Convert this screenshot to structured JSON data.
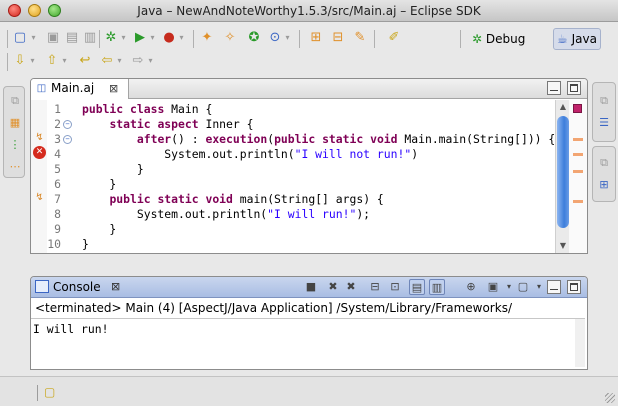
{
  "window": {
    "title": "Java – NewAndNoteWorthy1.5.3/src/Main.aj – Eclipse SDK"
  },
  "perspectives": {
    "debug": "Debug",
    "java": "Java"
  },
  "editor": {
    "tab_label": "Main.aj",
    "lines": [
      {
        "num": "1",
        "tokens": [
          {
            "k": "kw",
            "t": "public"
          },
          {
            "t": " "
          },
          {
            "k": "kw",
            "t": "class"
          },
          {
            "t": " Main {"
          }
        ]
      },
      {
        "num": "2",
        "tokens": [
          {
            "t": "    "
          },
          {
            "k": "kw",
            "t": "static"
          },
          {
            "t": " "
          },
          {
            "k": "kw",
            "t": "aspect"
          },
          {
            "t": " Inner {"
          }
        ]
      },
      {
        "num": "3",
        "tokens": [
          {
            "t": "        "
          },
          {
            "k": "kw",
            "t": "after"
          },
          {
            "t": "() : "
          },
          {
            "k": "kw",
            "t": "execution"
          },
          {
            "t": "("
          },
          {
            "k": "kw",
            "t": "public"
          },
          {
            "t": " "
          },
          {
            "k": "kw",
            "t": "static"
          },
          {
            "t": " "
          },
          {
            "k": "kw",
            "t": "void"
          },
          {
            "t": " Main.main(String[])) {"
          }
        ]
      },
      {
        "num": "4",
        "tokens": [
          {
            "t": "            System.out.println("
          },
          {
            "k": "str",
            "t": "\"I will not run!\""
          },
          {
            "t": ")"
          }
        ]
      },
      {
        "num": "5",
        "tokens": [
          {
            "t": "        }"
          }
        ]
      },
      {
        "num": "6",
        "tokens": [
          {
            "t": "    }"
          }
        ]
      },
      {
        "num": "7",
        "tokens": [
          {
            "t": "    "
          },
          {
            "k": "kw",
            "t": "public"
          },
          {
            "t": " "
          },
          {
            "k": "kw",
            "t": "static"
          },
          {
            "t": " "
          },
          {
            "k": "kw",
            "t": "void"
          },
          {
            "t": " main(String[] args) {"
          }
        ]
      },
      {
        "num": "8",
        "tokens": [
          {
            "t": "        System.out.println("
          },
          {
            "k": "str",
            "t": "\"I will run!\""
          },
          {
            "t": ");"
          }
        ]
      },
      {
        "num": "9",
        "tokens": [
          {
            "t": "    }"
          }
        ]
      },
      {
        "num": "10",
        "tokens": [
          {
            "t": "}"
          }
        ]
      }
    ]
  },
  "console": {
    "tab_label": "Console",
    "status_line": "<terminated> Main (4) [AspectJ/Java Application] /System/Library/Frameworks/",
    "output": "I will run!"
  }
}
